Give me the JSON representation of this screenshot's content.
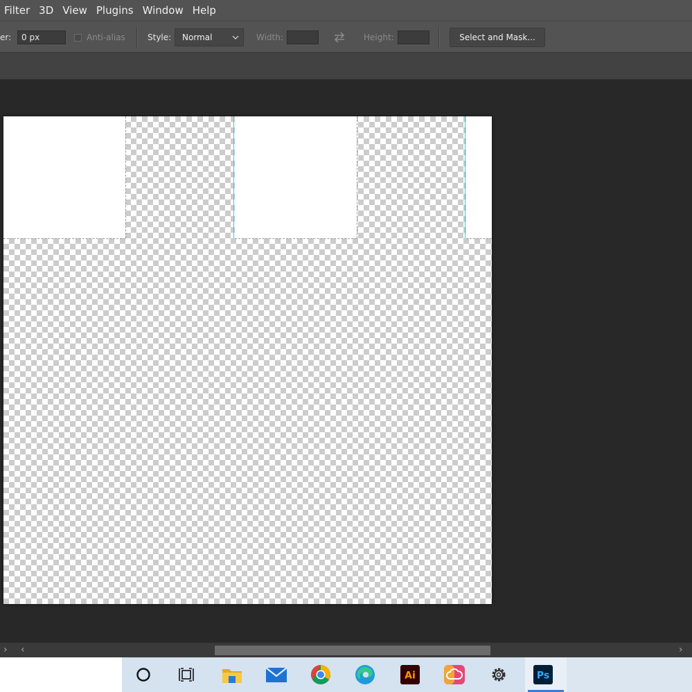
{
  "menubar": {
    "items": [
      "Filter",
      "3D",
      "View",
      "Plugins",
      "Window",
      "Help"
    ]
  },
  "options": {
    "feather_label": "er:",
    "feather_value": "0 px",
    "antialias_label": "Anti-alias",
    "style_label": "Style:",
    "style_value": "Normal",
    "width_label": "Width:",
    "height_label": "Height:",
    "select_mask_label": "Select and Mask..."
  },
  "scrollbar": {
    "left_arrow_1": "›",
    "left_arrow_2": "‹",
    "right_arrow": "›"
  },
  "taskbar": {
    "icons": [
      "cortana-icon",
      "task-view-icon",
      "file-explorer-icon",
      "mail-icon",
      "chrome-icon",
      "edge-icon",
      "illustrator-icon",
      "creative-cloud-icon",
      "settings-icon",
      "photoshop-icon"
    ],
    "illustrator_label": "Ai",
    "photoshop_label": "Ps"
  },
  "colors": {
    "guide": "#20d4ea",
    "taskbar": "#d5e2ef",
    "app_bg": "#282828"
  }
}
